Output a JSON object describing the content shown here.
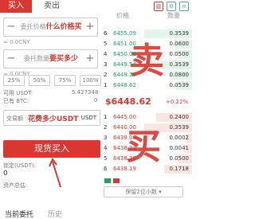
{
  "tabs": {
    "buy": "买入",
    "sell": "卖出"
  },
  "header": {
    "price": "价格",
    "qty": "数量"
  },
  "order": {
    "price_placeholder": "委托价格",
    "price_note": "什么价格买",
    "price_unit": "≈ 0.0CNY",
    "qty_placeholder": "委托数量",
    "qty_note": "要买多少",
    "pcts": [
      "25%",
      "50%",
      "75%",
      "100%"
    ],
    "available_label": "可用 USDT:",
    "available_value": "5.427348",
    "bought_label": "已有 BTC:",
    "bought_value": "0",
    "amount_label": "交易额",
    "amount_note": "花费多少USDT",
    "amount_unit": "USDT",
    "buy_button": "现货买入",
    "locked_label": "锁定(USDT):",
    "locked_value": "0",
    "total_label": "资产总估:",
    "bottom_left": "当前委托",
    "bottom_right": "历史"
  },
  "orderbook": {
    "asks": [
      {
        "idx": "6",
        "price": "6455.09",
        "qty": "0.3539"
      },
      {
        "idx": "5",
        "price": "6451.00",
        "qty": "0.0600"
      },
      {
        "idx": "4",
        "price": "6450.00",
        "qty": "0.0500"
      },
      {
        "idx": "3",
        "price": "6449.54",
        "qty": "0.3539"
      },
      {
        "idx": "2",
        "price": "6449.20",
        "qty": "0.0800"
      },
      {
        "idx": "1",
        "price": "6448.62",
        "qty": "0.0539"
      }
    ],
    "mid_price": "$6448.62",
    "mid_change": "+0.22%",
    "bids": [
      {
        "idx": "1",
        "price": "6445.00",
        "qty": "0.2400"
      },
      {
        "idx": "2",
        "price": "6440.00",
        "qty": "0.3539"
      },
      {
        "idx": "3",
        "price": "6439.00",
        "qty": "0.0002"
      },
      {
        "idx": "4",
        "price": "6438.23",
        "qty": "0.0041"
      },
      {
        "idx": "5",
        "price": "6438.20",
        "qty": "0.0500"
      },
      {
        "idx": "6",
        "price": "6438.19",
        "qty": "0.1718"
      }
    ],
    "precision_select": "保留2位小数",
    "overlay_sell": "卖",
    "overlay_buy": "买"
  },
  "colors": {
    "accent": "#d9372f",
    "ask": "#20a060"
  }
}
